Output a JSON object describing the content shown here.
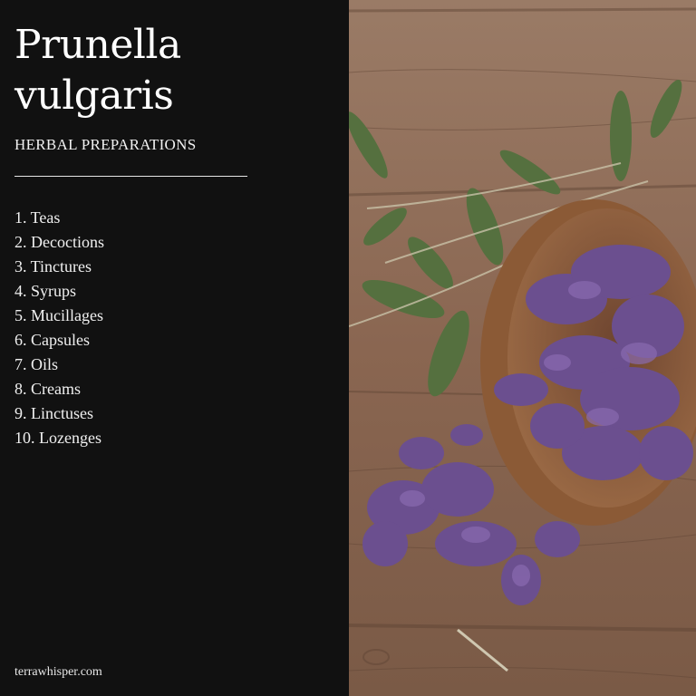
{
  "title": {
    "line1": "Prunella",
    "line2": "vulgaris"
  },
  "subtitle": "HERBAL PREPARATIONS",
  "preparations": [
    "1. Teas",
    "2. Decoctions",
    "3. Tinctures",
    "4. Syrups",
    "5. Mucillages",
    "6. Capsules",
    "7. Oils",
    "8. Creams",
    "9. Linctuses",
    "10. Lozenges"
  ],
  "footer": "terrawhisper.com",
  "photo": {
    "description_icon": "dried-herb-bowl-photo",
    "colors": {
      "wood": "#8a6a55",
      "flower": "#6b4f8f",
      "leaf": "#4f6a3f",
      "bowl": "#8b5a36"
    }
  }
}
